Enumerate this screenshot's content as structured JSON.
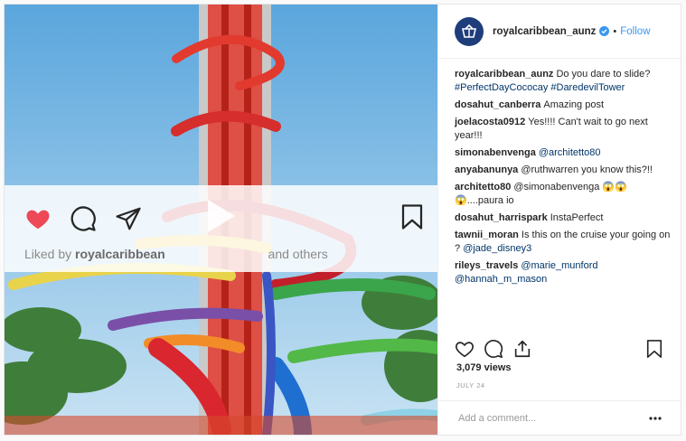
{
  "account": {
    "username": "royalcaribbean_aunz",
    "follow_label": "Follow",
    "separator": "•"
  },
  "comments": [
    {
      "user": "royalcaribbean_aunz",
      "text": "Do you dare to slide? ",
      "links": "#PerfectDayCococay #DaredevilTower"
    },
    {
      "user": "dosahut_canberra",
      "text": "Amazing post",
      "links": ""
    },
    {
      "user": "joelacosta0912",
      "text": "Yes!!!! Can't wait to go next year!!!",
      "links": ""
    },
    {
      "user": "simonabenvenga",
      "text": "",
      "links": "@architetto80"
    },
    {
      "user": "anyabanunya",
      "text": "@ruthwarren you know this?!!",
      "links": ""
    },
    {
      "user": "architetto80",
      "text": "@simonabenvenga 😱😱 😱....paura io",
      "links": ""
    },
    {
      "user": "dosahut_harrispark",
      "text": "InstaPerfect",
      "links": ""
    },
    {
      "user": "tawnii_moran",
      "text": "Is this on the cruise your going on ? ",
      "links": "@jade_disney3"
    },
    {
      "user": "rileys_travels",
      "text": "",
      "links": "@marie_munford @hannah_m_mason"
    }
  ],
  "views": "3,079 views",
  "date": "JULY 24",
  "add_comment_placeholder": "Add a comment...",
  "video_overlay": {
    "liked_prefix": "Liked by",
    "liked_user": "royalcaribbean",
    "liked_suffix": "and others"
  },
  "colors": {
    "accent": "#3897f0",
    "heart": "#ed4956",
    "sky": "#8ec3e8"
  },
  "icons": [
    "verified-badge-icon",
    "heart-icon",
    "comment-icon",
    "share-icon",
    "bookmark-icon",
    "play-icon",
    "more-icon"
  ]
}
